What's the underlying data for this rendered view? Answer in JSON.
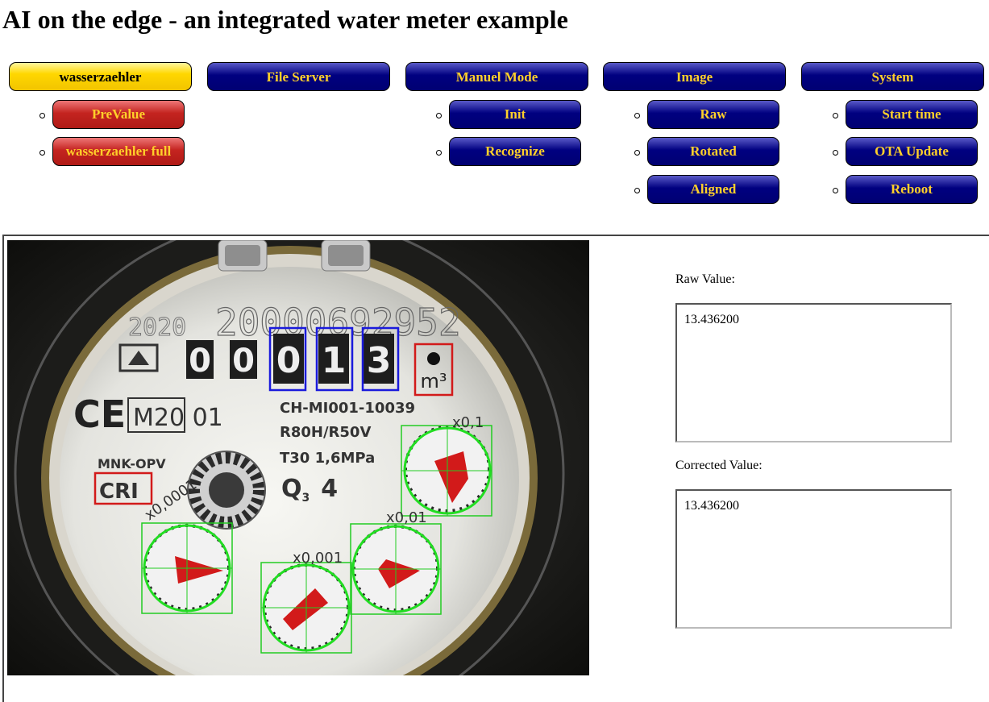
{
  "page": {
    "title": "AI on the edge - an integrated water meter example"
  },
  "nav": {
    "wasserzaehler": "wasserzaehler",
    "file_server": "File Server",
    "manuel_mode": "Manuel Mode",
    "image": "Image",
    "system": "System",
    "wasserzaehler_items": [
      "PreValue",
      "wasserzaehler full"
    ],
    "manuel_items": [
      "Init",
      "Recognize"
    ],
    "image_items": [
      "Raw",
      "Rotated",
      "Aligned"
    ],
    "system_items": [
      "Start time",
      "OTA Update",
      "Reboot"
    ]
  },
  "meter": {
    "year": "2020",
    "serial": "20000692952",
    "digits": [
      "0",
      "0",
      "0",
      "1",
      "3"
    ],
    "unit": "m³",
    "ce": "CE",
    "model": "M20 01",
    "code": "CH-MI001-10039",
    "ratio": "R80H/R50V",
    "temp": "T30  1,6MPa",
    "brand": "MNK-OPV",
    "cri": "CRI",
    "q": "Q",
    "q_sub": "3",
    "q_val": "4",
    "dial_labels": [
      "x0,1",
      "x0,01",
      "x0,001",
      "x0,0001"
    ]
  },
  "values": {
    "raw_label": "Raw Value:",
    "raw": "13.436200",
    "corrected_label": "Corrected Value:",
    "corrected": "13.436200"
  }
}
